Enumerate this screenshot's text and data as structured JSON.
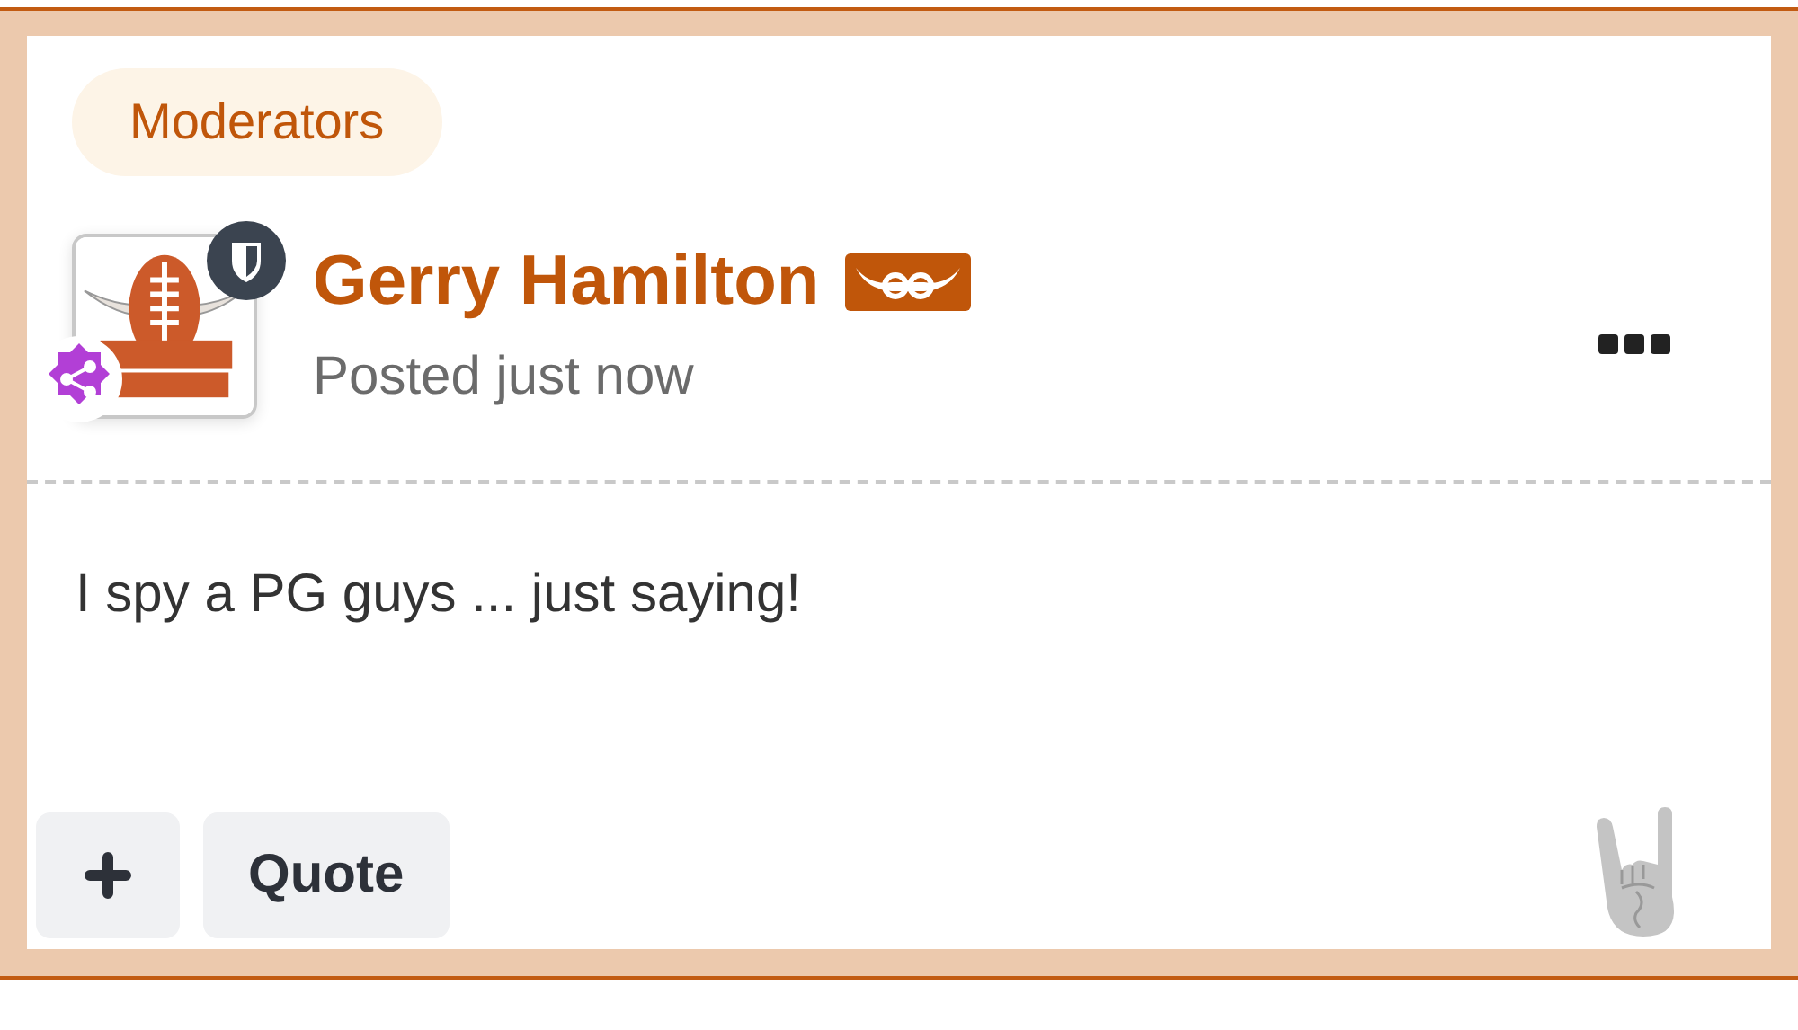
{
  "group_label": "Moderators",
  "author": {
    "name": "Gerry Hamilton",
    "meta": "Posted just now"
  },
  "body": "I spy a PG guys ... just saying!",
  "buttons": [
    {
      "kind": "add"
    },
    {
      "kind": "text",
      "label": "Quote"
    }
  ]
}
